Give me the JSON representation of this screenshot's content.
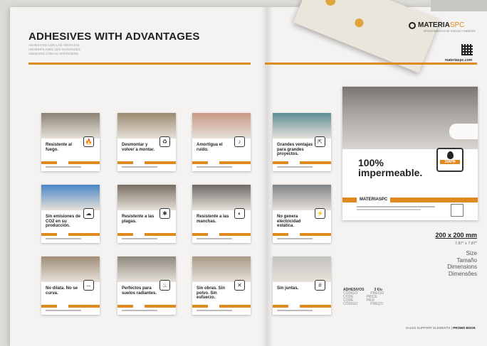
{
  "left_page": {
    "title": "ADHESIVES WITH ADVANTAGES",
    "subtitle_lines": [
      "ADHESIVOS CON LAS VENTAJAS",
      "ADHÉSIFS AVEC LES AVANTAGES",
      "ADESIVOS COM AS VANTAGENS"
    ]
  },
  "right_page": {
    "brand": {
      "name_bold": "MATERIA",
      "name_light": "SPC",
      "tagline": "REVESTIMIENTOS DE SUELOS Y PAREDES",
      "url": "materiaspc.com"
    },
    "featured": {
      "caption_line1": "100%",
      "caption_line2": "impermeable.",
      "badge": "100%",
      "band_logo": "MATERIASPC"
    },
    "size": {
      "value": "200 x 200 mm",
      "inches": "7.87\" x 7.87\"",
      "labels": [
        "Size",
        "Tamaño",
        "Dimensions",
        "Dimensões"
      ]
    },
    "table": {
      "header": [
        "ADHESIVOS",
        "3 €/u"
      ],
      "rows": [
        [
          "CÓDIGO",
          "PRECIO"
        ],
        [
          "CODE",
          "PRICE"
        ],
        [
          "CODE",
          "PRIX"
        ],
        [
          "CÓDIGO",
          "PREÇO"
        ]
      ]
    },
    "footer": {
      "section": "SALES SUPPORT ELEMENTS",
      "book": "PROMO BOOK"
    }
  },
  "cards": [
    {
      "caption": "Resistente al fuego.",
      "icon": "fire-icon",
      "glyph": "🔥",
      "color": "#8a8273"
    },
    {
      "caption": "Desmontar y volver a montar.",
      "icon": "recycle-icon",
      "glyph": "♻",
      "color": "#9b8a70"
    },
    {
      "caption": "Amortigua el ruido.",
      "icon": "sound-icon",
      "glyph": "♪",
      "color": "#c89a84"
    },
    {
      "caption": "Grandes ventajas para grandes proyectos.",
      "icon": "expand-icon",
      "glyph": "⇱",
      "color": "#5f8d94"
    },
    {
      "caption": "Sin emisiones de CO2 en su producción.",
      "icon": "co2-icon",
      "glyph": "☁",
      "color": "#4a86c5"
    },
    {
      "caption": "Resistente a las plagas.",
      "icon": "bug-icon",
      "glyph": "✱",
      "color": "#7a6e62"
    },
    {
      "caption": "Resistente a las manchas.",
      "icon": "stain-icon",
      "glyph": "◐",
      "color": "#6e6a66"
    },
    {
      "caption": "No genera electricidad estática.",
      "icon": "bolt-icon",
      "glyph": "⚡",
      "color": "#7f8386"
    },
    {
      "caption": "No dilata. No se curva.",
      "icon": "arrows-icon",
      "glyph": "↔",
      "color": "#a08d78"
    },
    {
      "caption": "Perfectos para suelos radiantes.",
      "icon": "heat-icon",
      "glyph": "♨",
      "color": "#8f887f"
    },
    {
      "caption": "Sin obras. Sin polvo. Sin esfuerzo.",
      "icon": "tools-icon",
      "glyph": "✕",
      "color": "#a99a86"
    },
    {
      "caption": "Sin juntas.",
      "icon": "grid-icon",
      "glyph": "#",
      "color": "#c5c3bf"
    }
  ]
}
